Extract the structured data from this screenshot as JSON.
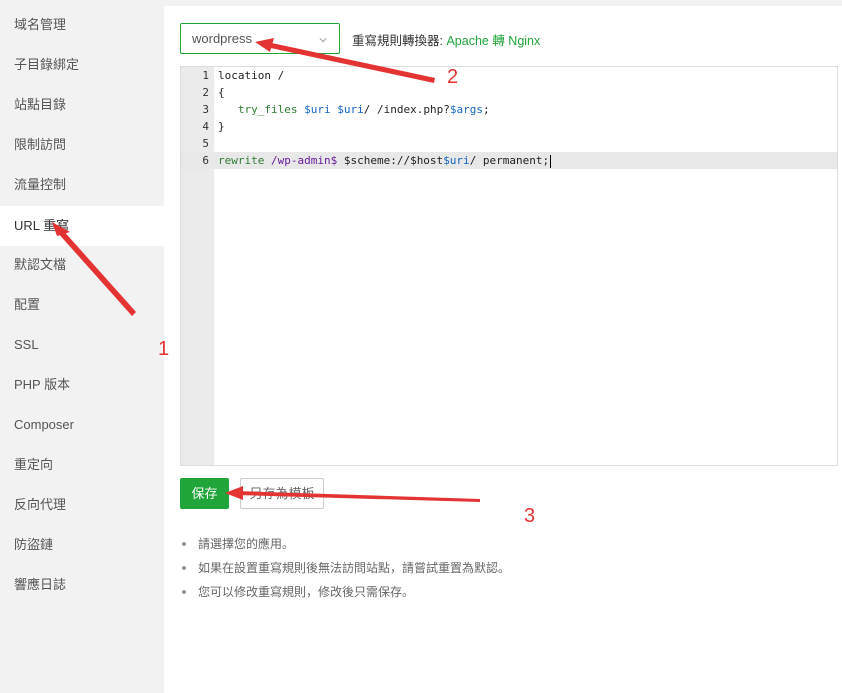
{
  "sidebar": {
    "items": [
      {
        "label": "域名管理"
      },
      {
        "label": "子目錄綁定"
      },
      {
        "label": "站點目錄"
      },
      {
        "label": "限制訪問"
      },
      {
        "label": "流量控制"
      },
      {
        "label": "URL 重寫",
        "active": true
      },
      {
        "label": "默認文檔"
      },
      {
        "label": "配置"
      },
      {
        "label": "SSL"
      },
      {
        "label": "PHP 版本"
      },
      {
        "label": "Composer"
      },
      {
        "label": "重定向"
      },
      {
        "label": "反向代理"
      },
      {
        "label": "防盜鏈"
      },
      {
        "label": "響應日誌"
      }
    ]
  },
  "rewrite": {
    "select_value": "wordpress",
    "converter_label": "重寫規則轉換器: ",
    "converter_link": "Apache 轉 Nginx"
  },
  "editor": {
    "line_numbers": [
      "1",
      "2",
      "3",
      "4",
      "5",
      "6"
    ],
    "lines": [
      "location /",
      "{",
      "   try_files $uri $uri/ /index.php?$args;",
      "}",
      "",
      "rewrite /wp-admin$ $scheme://$host$uri/ permanent;"
    ],
    "active_line": 6
  },
  "buttons": {
    "save_label": "保存",
    "template_label": "另存為模板"
  },
  "tips": [
    "請選擇您的應用。",
    "如果在設置重寫規則後無法訪問站點，請嘗試重置為默認。",
    "您可以修改重寫規則，修改後只需保存。"
  ],
  "annotations": {
    "color": "#e43333",
    "step1": "1",
    "step2": "2",
    "step3": "3"
  },
  "colors": {
    "accent": "#20a53a",
    "sidebar_bg": "#f2f2f2"
  }
}
